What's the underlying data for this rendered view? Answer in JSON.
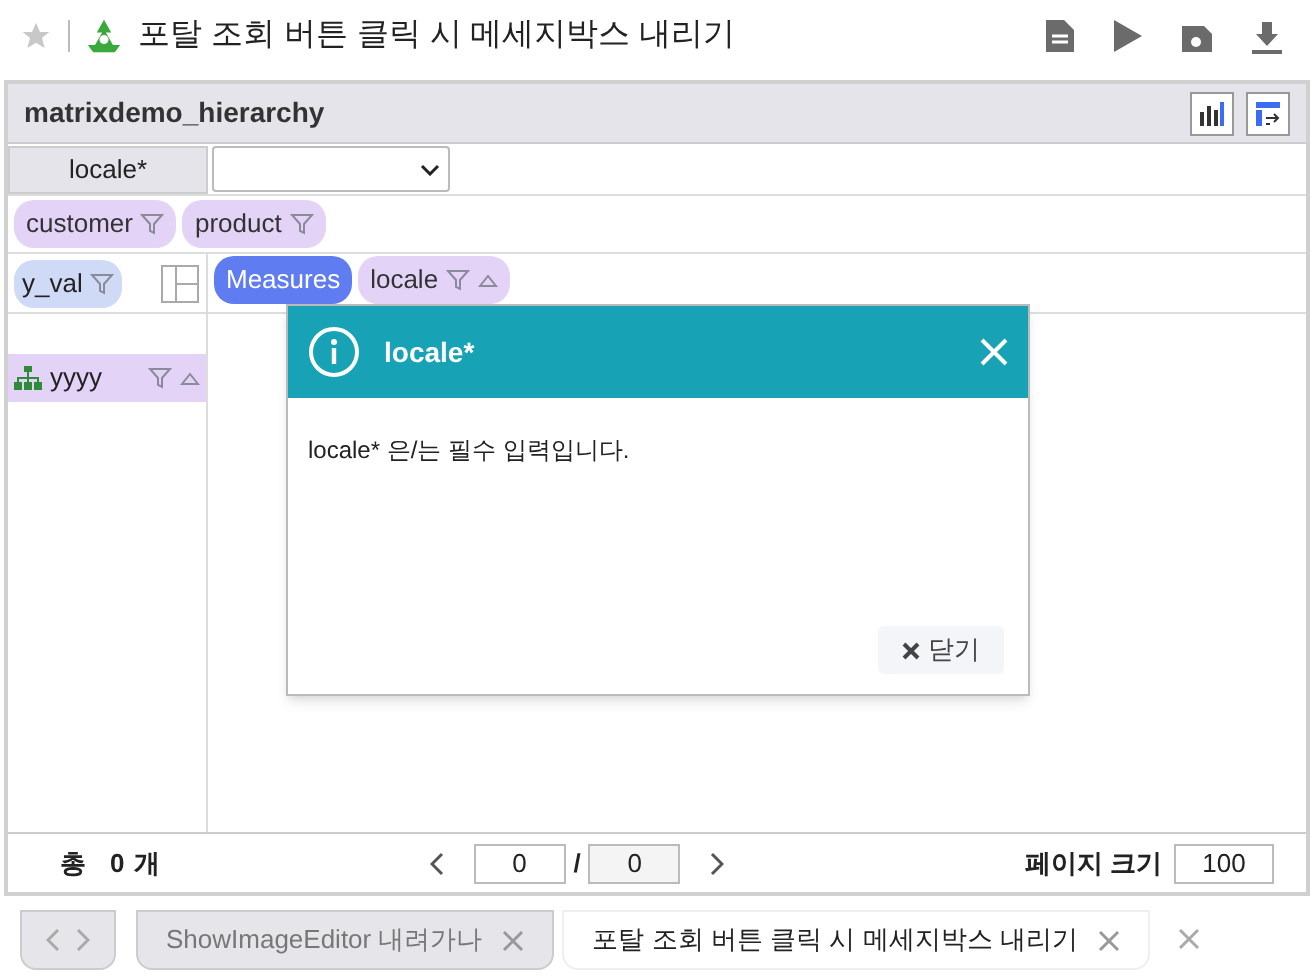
{
  "toolbar": {
    "title": "포탈 조회 버튼 클릭 시 메세지박스 내리기"
  },
  "panel": {
    "title": "matrixdemo_hierarchy"
  },
  "filter": {
    "label": "locale*"
  },
  "column_chips": [
    {
      "label": "customer"
    },
    {
      "label": "product"
    }
  ],
  "row_chips": [
    {
      "label": "y_val"
    }
  ],
  "measure_chips": [
    {
      "label": "Measures",
      "kind": "measure"
    },
    {
      "label": "locale",
      "kind": "dimension"
    }
  ],
  "row_header": {
    "label": "yyyy"
  },
  "footer": {
    "total_label": "총",
    "count": "0",
    "unit": "개",
    "page": "0",
    "separator": "/",
    "pages": "0",
    "page_size_label": "페이지 크기",
    "page_size": "100"
  },
  "tabs": [
    {
      "label": "ShowImageEditor 내려가나",
      "selected": false
    },
    {
      "label": "포탈 조회 버튼 클릭 시 메세지박스 내리기",
      "selected": true
    }
  ],
  "dialog": {
    "title": "locale*",
    "message": "locale* 은/는 필수 입력입니다.",
    "close_button": "닫기"
  }
}
